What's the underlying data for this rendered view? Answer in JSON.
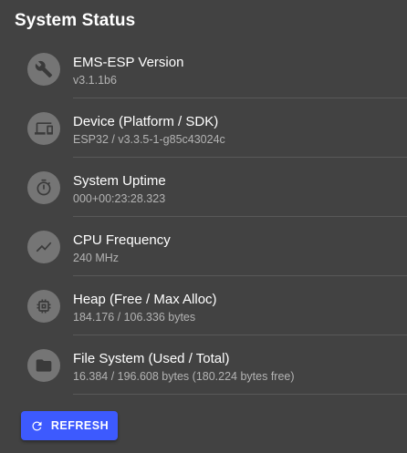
{
  "page": {
    "title": "System Status"
  },
  "items": [
    {
      "icon": "wrench-icon",
      "primary": "EMS-ESP Version",
      "secondary": "v3.1.1b6"
    },
    {
      "icon": "devices-icon",
      "primary": "Device (Platform / SDK)",
      "secondary": "ESP32 / v3.3.5-1-g85c43024c"
    },
    {
      "icon": "timer-icon",
      "primary": "System Uptime",
      "secondary": "000+00:23:28.323"
    },
    {
      "icon": "trending-up-icon",
      "primary": "CPU Frequency",
      "secondary": "240 MHz"
    },
    {
      "icon": "memory-chip-icon",
      "primary": "Heap (Free / Max Alloc)",
      "secondary": "184.176 / 106.336 bytes"
    },
    {
      "icon": "folder-icon",
      "primary": "File System (Used / Total)",
      "secondary": "16.384 / 196.608 bytes (180.224 bytes free)"
    }
  ],
  "actions": {
    "refresh_label": "REFRESH",
    "refresh_icon": "refresh-icon"
  },
  "colors": {
    "background": "#424242",
    "avatar": "#757575",
    "secondary_text": "#b3b3b3",
    "accent": "#3d5afe"
  }
}
